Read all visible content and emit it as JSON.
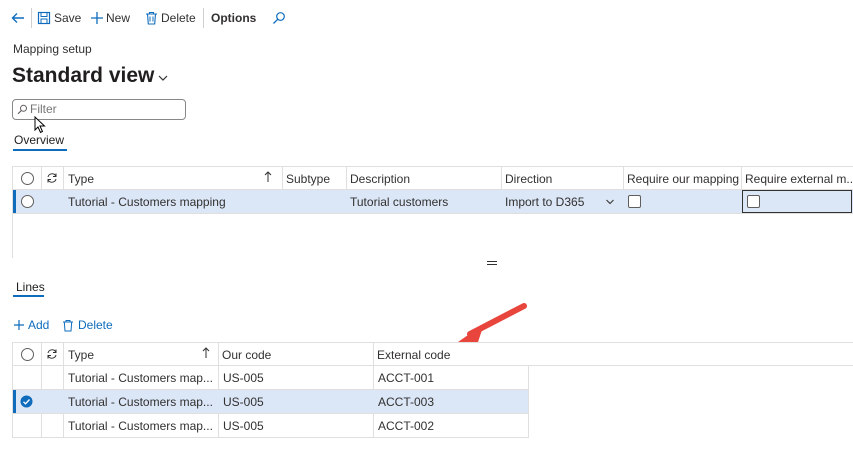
{
  "toolbar": {
    "save_label": "Save",
    "new_label": "New",
    "delete_label": "Delete",
    "options_label": "Options"
  },
  "page": {
    "breadcrumb": "Mapping setup",
    "view_title": "Standard view",
    "filter_placeholder": "Filter",
    "tab_overview": "Overview"
  },
  "grid1": {
    "headers": {
      "type": "Type",
      "subtype": "Subtype",
      "description": "Description",
      "direction": "Direction",
      "require_our": "Require our mapping",
      "require_external": "Require external m..."
    },
    "rows": [
      {
        "type": "Tutorial - Customers mapping",
        "subtype": "",
        "description": "Tutorial customers",
        "direction": "Import to D365"
      }
    ]
  },
  "lines": {
    "tab_label": "Lines",
    "add_label": "Add",
    "delete_label": "Delete",
    "headers": {
      "type": "Type",
      "our_code": "Our code",
      "external_code": "External code"
    },
    "rows": [
      {
        "type": "Tutorial - Customers map...",
        "our_code": "US-005",
        "external_code": "ACCT-001"
      },
      {
        "type": "Tutorial - Customers map...",
        "our_code": "US-005",
        "external_code": "ACCT-003"
      },
      {
        "type": "Tutorial - Customers map...",
        "our_code": "US-005",
        "external_code": "ACCT-002"
      }
    ]
  },
  "colors": {
    "accent": "#0f6cbd",
    "selected_row": "#dbe6f6",
    "arrow": "#e8453c"
  }
}
